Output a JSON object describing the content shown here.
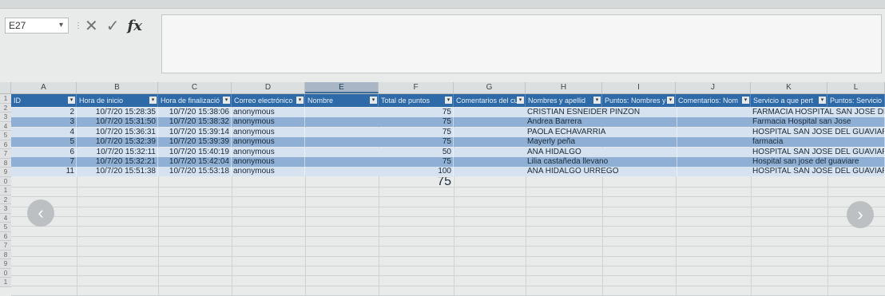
{
  "namebox": {
    "value": "E27",
    "chevron": "▾"
  },
  "formula_buttons": {
    "cancel": "✕",
    "enter": "✓",
    "fx": "fx"
  },
  "columns": [
    "A",
    "B",
    "C",
    "D",
    "E",
    "F",
    "G",
    "H",
    "I",
    "J",
    "K",
    "L"
  ],
  "selected_column": "E",
  "headers": [
    "ID",
    "Hora de inicio",
    "Hora de finalizació",
    "Correo electrónico",
    "Nombre",
    "Total de puntos",
    "Comentarios del cu",
    "Nombres y apellid",
    "Puntos: Nombres y",
    "Comentarios: Nom",
    "Servicio a que pert",
    "Puntos: Servicio"
  ],
  "rows": [
    {
      "id": "2",
      "start": "10/7/20 15:28:35",
      "end": "10/7/20 15:38:06",
      "email": "anonymous",
      "total": "75",
      "name": "CRISTIAN ESNEIDER PINZON",
      "service": "FARMACIA HOSPITAL SAN JOSE DEL G"
    },
    {
      "id": "3",
      "start": "10/7/20 15:31:50",
      "end": "10/7/20 15:38:32",
      "email": "anonymous",
      "total": "75",
      "name": "Andrea Barrera",
      "service": "Farmacia Hospital san Jose"
    },
    {
      "id": "4",
      "start": "10/7/20 15:36:31",
      "end": "10/7/20 15:39:14",
      "email": "anonymous",
      "total": "75",
      "name": "PAOLA ECHAVARRIA",
      "service": "HOSPITAL SAN JOSE DEL GUAVIARE"
    },
    {
      "id": "5",
      "start": "10/7/20 15:32:39",
      "end": "10/7/20 15:39:39",
      "email": "anonymous",
      "total": "75",
      "name": "Mayerly peña",
      "service": "farmacia"
    },
    {
      "id": "6",
      "start": "10/7/20 15:32:11",
      "end": "10/7/20 15:40:19",
      "email": "anonymous",
      "total": "50",
      "name": "ANA HIDALGO",
      "service": "HOSPITAL SAN JOSE DEL GUAVIARE"
    },
    {
      "id": "7",
      "start": "10/7/20 15:32:21",
      "end": "10/7/20 15:42:04",
      "email": "anonymous",
      "total": "75",
      "name": "Lilia castañeda llevano",
      "service": "Hospital san jose del guaviare"
    },
    {
      "id": "11",
      "start": "10/7/20 15:51:38",
      "end": "10/7/20 15:53:18",
      "email": "anonymous",
      "total": "100",
      "name": "ANA HIDALGO URREGO",
      "service": "HOSPITAL SAN JOSE DEL GUAVIARE"
    }
  ],
  "extra_total": "75",
  "row_numbers": [
    "1",
    "2",
    "3",
    "4",
    "5",
    "6",
    "7",
    "8",
    "9",
    "0",
    "1",
    "2",
    "3",
    "4",
    "5",
    "6",
    "7",
    "8",
    "9",
    "0",
    "1"
  ],
  "nav": {
    "prev": "‹",
    "next": "›"
  },
  "colors": {
    "header_blue": "#2e6aa8",
    "row_dark": "#8fb0d4",
    "row_light": "#d6e2ef"
  }
}
